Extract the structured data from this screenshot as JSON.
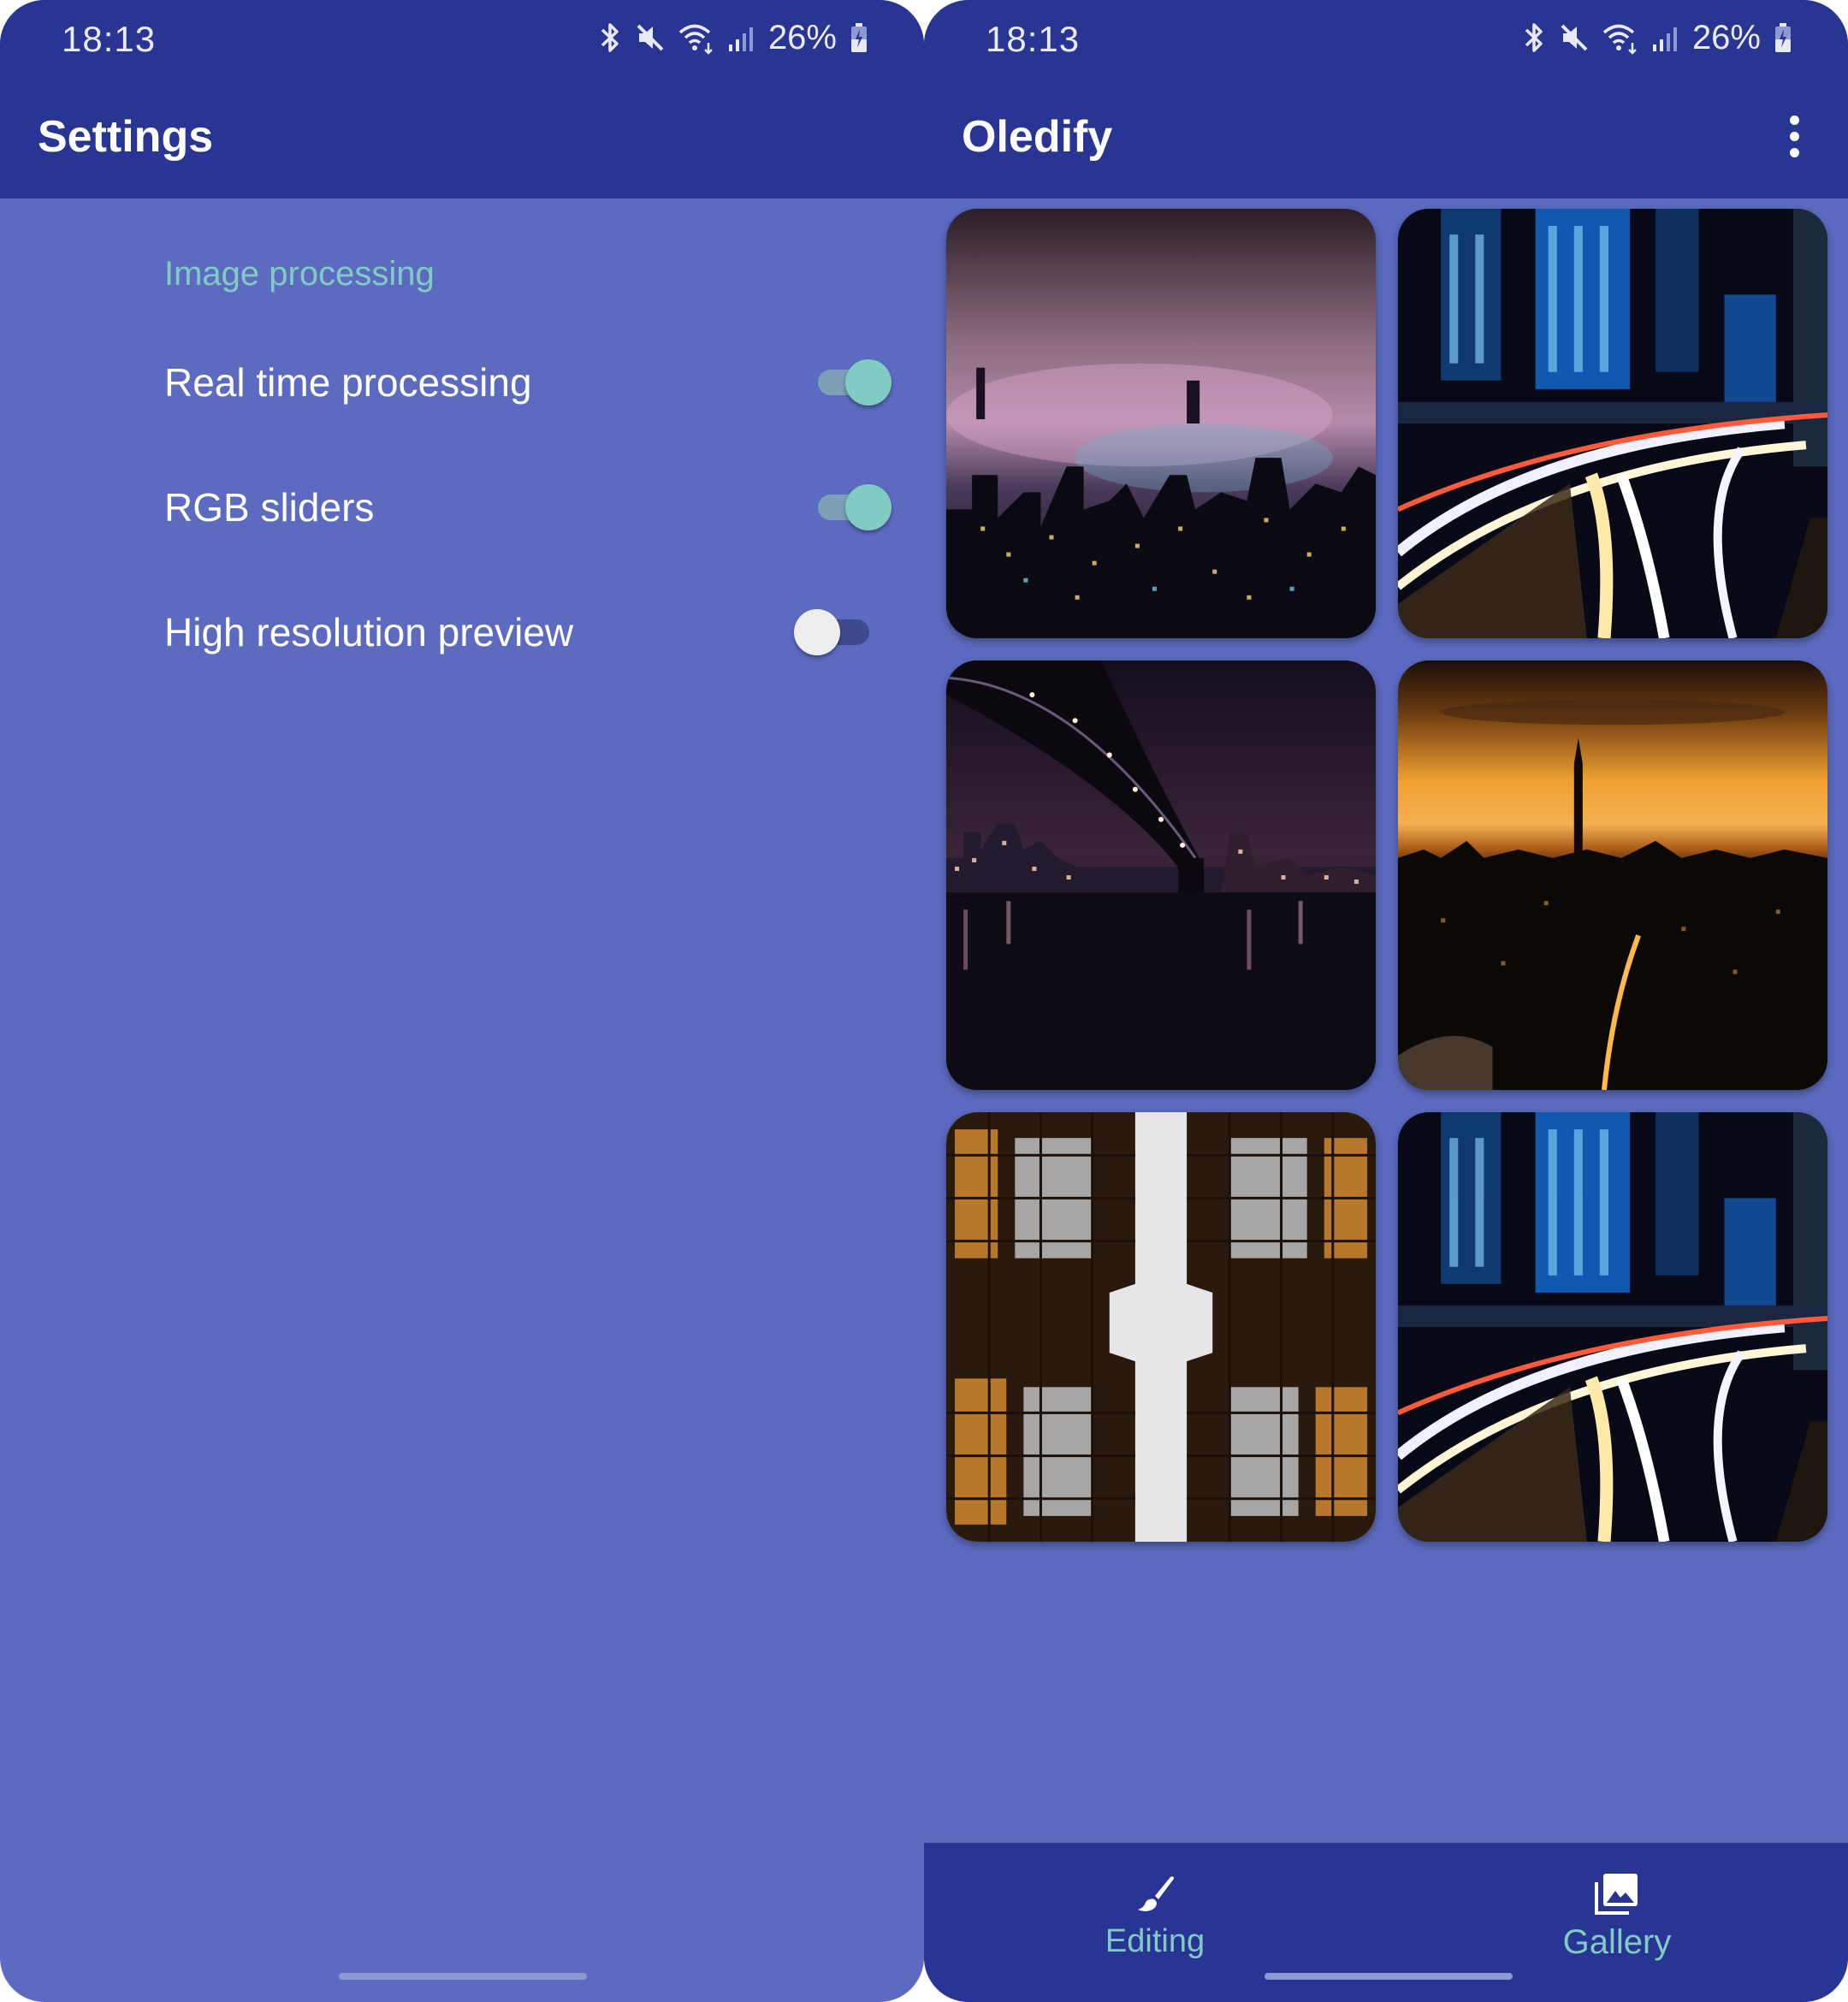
{
  "settings_screen": {
    "status_bar": {
      "time": "18:13",
      "battery": "26%"
    },
    "app_bar": {
      "title": "Settings"
    },
    "category": "Image processing",
    "preferences": [
      {
        "label": "Real time processing",
        "enabled": true
      },
      {
        "label": "RGB sliders",
        "enabled": true
      },
      {
        "label": "High resolution preview",
        "enabled": false
      }
    ]
  },
  "gallery_screen": {
    "status_bar": {
      "time": "18:13",
      "battery": "26%"
    },
    "app_bar": {
      "title": "Oledify",
      "overflow_icon": "more-vert-icon"
    },
    "images": [
      {
        "subject": "foggy city skyline at night"
      },
      {
        "subject": "highway light trails among skyscrapers"
      },
      {
        "subject": "bridge over river at night"
      },
      {
        "subject": "city skyline at sunset"
      },
      {
        "subject": "looking up between glass towers"
      },
      {
        "subject": "highway light trails among skyscrapers"
      }
    ],
    "bottom_nav": [
      {
        "label": "Editing",
        "icon": "brush-icon",
        "selected": false
      },
      {
        "label": "Gallery",
        "icon": "gallery-icon",
        "selected": true
      }
    ]
  },
  "colors": {
    "primary": "#283593",
    "background": "#5c6bc0",
    "accent": "#80cbc4"
  }
}
